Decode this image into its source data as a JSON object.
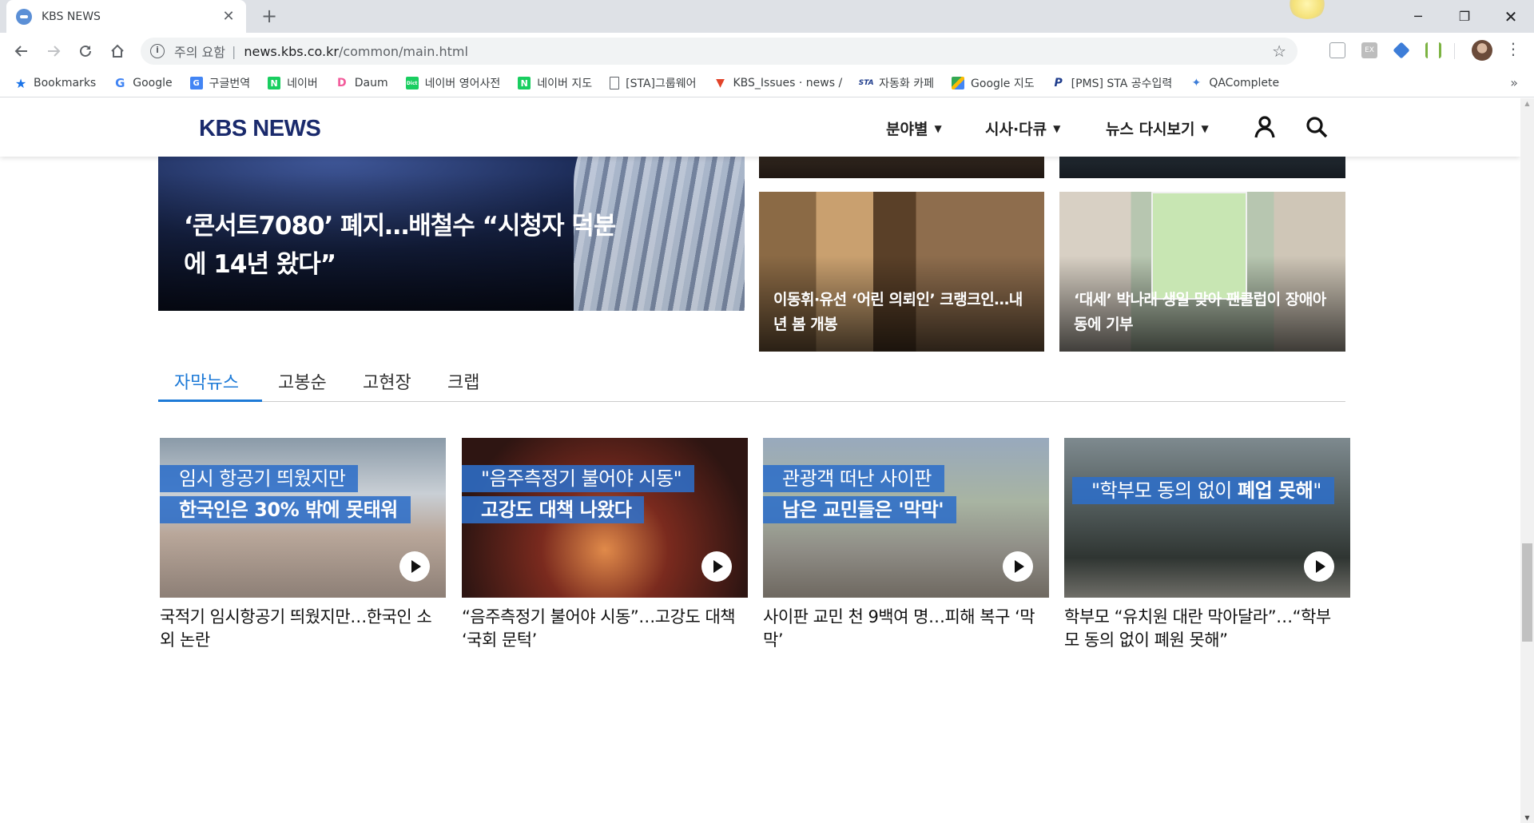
{
  "browser": {
    "tab_title": "KBS NEWS",
    "tab_close": "✕",
    "new_tab": "+",
    "security_label": "주의 요함",
    "security_sep": "|",
    "url_host": "news.kbs.co.kr",
    "url_path": "/common/main.html",
    "window_min": "─",
    "window_max": "❐",
    "window_close": "✕"
  },
  "bookmarks": [
    {
      "label": "Bookmarks",
      "icon": "star-icon"
    },
    {
      "label": "Google",
      "icon": "google-icon"
    },
    {
      "label": "구글번역",
      "icon": "google-translate-icon"
    },
    {
      "label": "네이버",
      "icon": "naver-icon"
    },
    {
      "label": "Daum",
      "icon": "daum-icon"
    },
    {
      "label": "네이버 영어사전",
      "icon": "naver-dict-icon"
    },
    {
      "label": "네이버 지도",
      "icon": "naver-map-icon"
    },
    {
      "label": "[STA]그룹웨어",
      "icon": "document-icon"
    },
    {
      "label": "KBS_Issues · news / ",
      "icon": "gitlab-icon"
    },
    {
      "label": "자동화 카페",
      "icon": "sta-icon"
    },
    {
      "label": "Google 지도",
      "icon": "google-maps-icon"
    },
    {
      "label": "[PMS] STA 공수입력",
      "icon": "pms-icon"
    },
    {
      "label": "QAComplete",
      "icon": "qacomplete-icon"
    }
  ],
  "bookmarks_more": "»",
  "site": {
    "logo": "KBS NEWS",
    "nav": [
      {
        "label": "분야별"
      },
      {
        "label": "시사·다큐"
      },
      {
        "label": "뉴스 다시보기"
      }
    ]
  },
  "top_news": {
    "hero_title": "‘콘서트7080’ 폐지…배철수 “시청자 덕분에 14년 왔다”",
    "cards": [
      {
        "caption": "이동휘·유선 ‘어린 의뢰인’ 크랭크인…내년 봄 개봉"
      },
      {
        "caption": "‘대세’ 박나래 생일 맞아 팬클럽이 장애아동에 기부"
      }
    ]
  },
  "tabs": [
    {
      "label": "자막뉴스",
      "active": true
    },
    {
      "label": "고봉순",
      "active": false
    },
    {
      "label": "고현장",
      "active": false
    },
    {
      "label": "크랩",
      "active": false
    }
  ],
  "videos": [
    {
      "sub1": "임시 항공기 띄웠지만",
      "sub2": "한국인은 30% 밖에 못태워",
      "title": "국적기 임시항공기 띄웠지만…한국인 소외 논란"
    },
    {
      "sub1": "\"음주측정기 불어야 시동\"",
      "sub2": "고강도 대책 나왔다",
      "title": "“음주측정기 불어야 시동”…고강도 대책 ‘국회 문턱’"
    },
    {
      "sub1": "관광객 떠난 사이판",
      "sub2": "남은 교민들은 '막막'",
      "title": "사이판 교민 천 9백여 명…피해 복구 ‘막막’"
    },
    {
      "sub1": "\"학부모 동의 없이 ",
      "sub1_bold": "폐업 못해",
      "sub1_end": "\"",
      "title": "학부모 “유치원 대란 막아달라”…“학부모 동의 없이 폐원 못해”"
    }
  ]
}
